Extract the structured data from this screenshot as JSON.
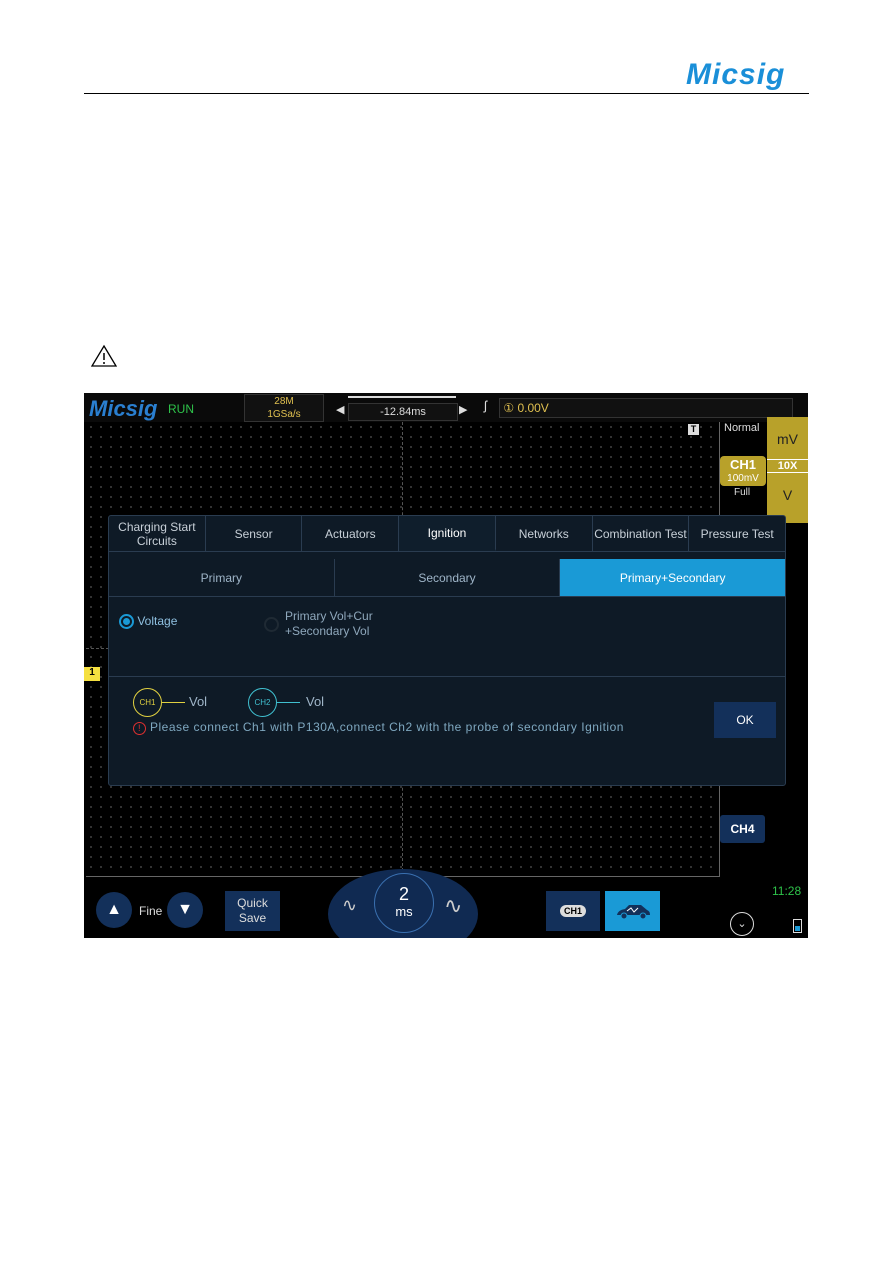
{
  "document": {
    "brand": "Micsig"
  },
  "scope": {
    "logo": "Micsig",
    "status": "RUN",
    "memory_depth": "28M",
    "sample_rate": "1GSa/s",
    "trigger_delay": "-12.84ms",
    "trigger_level": "0.00V",
    "trigger_mode": "Normal",
    "unit_top": "mV",
    "probe": "10X",
    "unit_bottom": "V",
    "ch1_label": "CH1",
    "ch1_scale": "100mV",
    "bandwidth": "Full",
    "ch1_marker": "1",
    "trigger_tag": "T",
    "ch4_label": "CH4",
    "clock": "11:28",
    "dialog": {
      "tabs": [
        {
          "label": "Charging Start Circuits"
        },
        {
          "label": "Sensor"
        },
        {
          "label": "Actuators"
        },
        {
          "label": "Ignition",
          "active": true
        },
        {
          "label": "Networks"
        },
        {
          "label": "Combination Test"
        },
        {
          "label": "Pressure Test"
        }
      ],
      "subtabs": [
        {
          "label": "Primary"
        },
        {
          "label": "Secondary"
        },
        {
          "label": "Primary+Secondary",
          "active": true
        }
      ],
      "option_voltage": "Voltage",
      "option_combo_line1": "Primary Vol+Cur",
      "option_combo_line2": "+Secondary Vol",
      "selected_option": "Voltage",
      "ch1": "CH1",
      "ch1_signal": "Vol",
      "ch2": "CH2",
      "ch2_signal": "Vol",
      "message": "Please connect Ch1 with P130A,connect Ch2 with the probe of secondary Ignition",
      "ok_label": "OK"
    },
    "bottom": {
      "fine_label": "Fine",
      "quick_save_line1": "Quick",
      "quick_save_line2": "Save",
      "timebase_value": "2",
      "timebase_unit": "ms",
      "channel_button": "CH1"
    }
  },
  "colors": {
    "accent": "#1a9ad6",
    "ch1": "#e0d040",
    "ch2": "#40c0d0",
    "brand": "#1a8fd8"
  }
}
